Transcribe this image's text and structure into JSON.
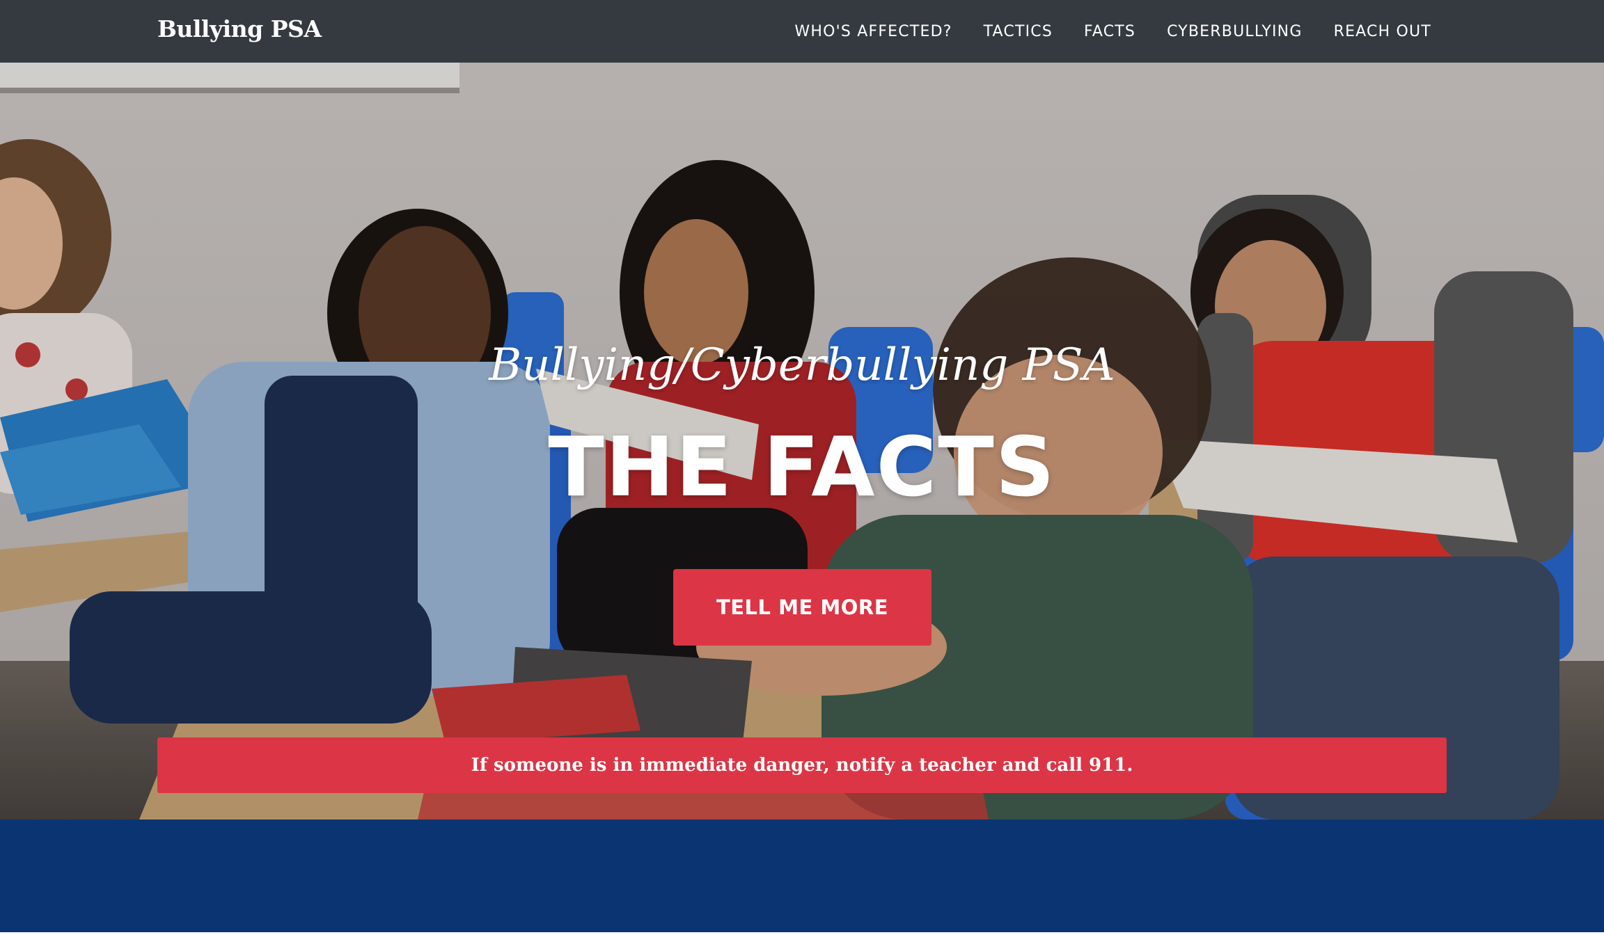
{
  "navbar": {
    "brand": "Bullying PSA",
    "links": [
      {
        "label": "WHO'S AFFECTED?"
      },
      {
        "label": "TACTICS"
      },
      {
        "label": "FACTS"
      },
      {
        "label": "CYBERBULLYING"
      },
      {
        "label": "REACH OUT"
      }
    ]
  },
  "hero": {
    "subheading": "Bullying/Cyberbullying PSA",
    "heading": "THE FACTS",
    "button_label": "TELL ME MORE",
    "alert": "If someone is in immediate danger, notify a teacher and call 911."
  },
  "colors": {
    "navbar": "#343a40",
    "accent_red": "#dc3545",
    "section_blue": "#0b3572"
  }
}
